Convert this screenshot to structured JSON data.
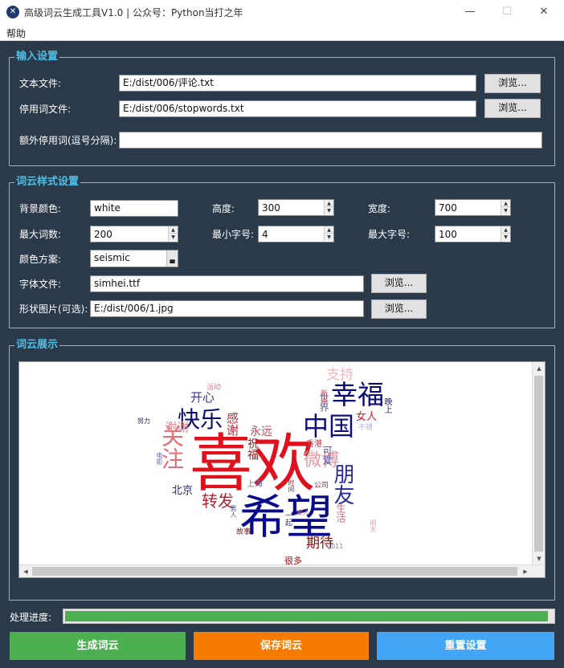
{
  "window": {
    "title": "高级词云生成工具V1.0 | 公众号：Python当打之年",
    "min": "—",
    "max": "☐",
    "close": "✕"
  },
  "menu": {
    "help": "帮助"
  },
  "input_settings": {
    "title": "输入设置",
    "text_file_label": "文本文件:",
    "text_file_value": "E:/dist/006/评论.txt",
    "stopword_label": "停用词文件:",
    "stopword_value": "E:/dist/006/stopwords.txt",
    "extra_label": "额外停用词(逗号分隔):",
    "extra_value": "",
    "browse": "浏览..."
  },
  "style_settings": {
    "title": "词云样式设置",
    "bg_label": "背景颜色:",
    "bg_value": "white",
    "height_label": "高度:",
    "height_value": "300",
    "width_label": "宽度:",
    "width_value": "700",
    "max_words_label": "最大词数:",
    "max_words_value": "200",
    "min_font_label": "最小字号:",
    "min_font_value": "4",
    "max_font_label": "最大字号:",
    "max_font_value": "100",
    "colormap_label": "颜色方案:",
    "colormap_value": "seismic",
    "font_label": "字体文件:",
    "font_value": "simhei.ttf",
    "mask_label": "形状图片(可选):",
    "mask_value": "E:/dist/006/1.jpg",
    "browse": "浏览..."
  },
  "display": {
    "title": "词云展示",
    "words": [
      {
        "t": "喜欢",
        "c": "#e0101c"
      },
      {
        "t": "希望",
        "c": "#0a0a8c"
      },
      {
        "t": "关注",
        "c": "#e0707a"
      },
      {
        "t": "快乐",
        "c": "#0a0a6a"
      },
      {
        "t": "幸福",
        "c": "#0a0a7a"
      },
      {
        "t": "中国",
        "c": "#10107a"
      },
      {
        "t": "微博",
        "c": "#e89aa0"
      },
      {
        "t": "朋友",
        "c": "#2a2a9a"
      },
      {
        "t": "转发",
        "c": "#b02030"
      },
      {
        "t": "期待",
        "c": "#7a1010"
      },
      {
        "t": "谢谢",
        "c": "#e08a90"
      },
      {
        "t": "感谢",
        "c": "#c03040"
      },
      {
        "t": "开心",
        "c": "#3a3a8a"
      },
      {
        "t": "支持",
        "c": "#f0b8bc"
      },
      {
        "t": "永远",
        "c": "#c05060"
      },
      {
        "t": "祝福",
        "c": "#8a2a2a"
      },
      {
        "t": "女人",
        "c": "#d02030"
      },
      {
        "t": "北京",
        "c": "#2a2a6a"
      },
      {
        "t": "世界",
        "c": "#6060a0"
      },
      {
        "t": "生活",
        "c": "#d07080"
      },
      {
        "t": "可爱",
        "c": "#5050a0"
      },
      {
        "t": "很多",
        "c": "#a01010"
      },
      {
        "t": "香港",
        "c": "#c04050"
      },
      {
        "t": "上海",
        "c": "#6a6ab0"
      },
      {
        "t": "晚上",
        "c": "#2a2a7a"
      },
      {
        "t": "活动",
        "c": "#d08090"
      },
      {
        "t": "一起",
        "c": "#3a3a7a"
      },
      {
        "t": "故事",
        "c": "#7a2020"
      },
      {
        "t": "新闻",
        "c": "#c06070"
      },
      {
        "t": "不错",
        "c": "#b0b0d8"
      },
      {
        "t": "公司",
        "c": "#a03040"
      },
      {
        "t": "男人",
        "c": "#4a4a8a"
      },
      {
        "t": "努力",
        "c": "#303070"
      },
      {
        "t": "明天",
        "c": "#e0a0a8"
      },
      {
        "t": "电影",
        "c": "#6a6aa8"
      },
      {
        "t": "时间",
        "c": "#a02030"
      },
      {
        "t": "家人",
        "c": "#c07888"
      },
      {
        "t": "2011",
        "c": "#8080b0"
      }
    ]
  },
  "progress": {
    "label": "处理进度:",
    "value": 0.99
  },
  "actions": {
    "generate": "生成词云",
    "generate_color": "#4caf50",
    "save": "保存词云",
    "save_color": "#f57c00",
    "reset": "重置设置",
    "reset_color": "#42a5f5"
  }
}
